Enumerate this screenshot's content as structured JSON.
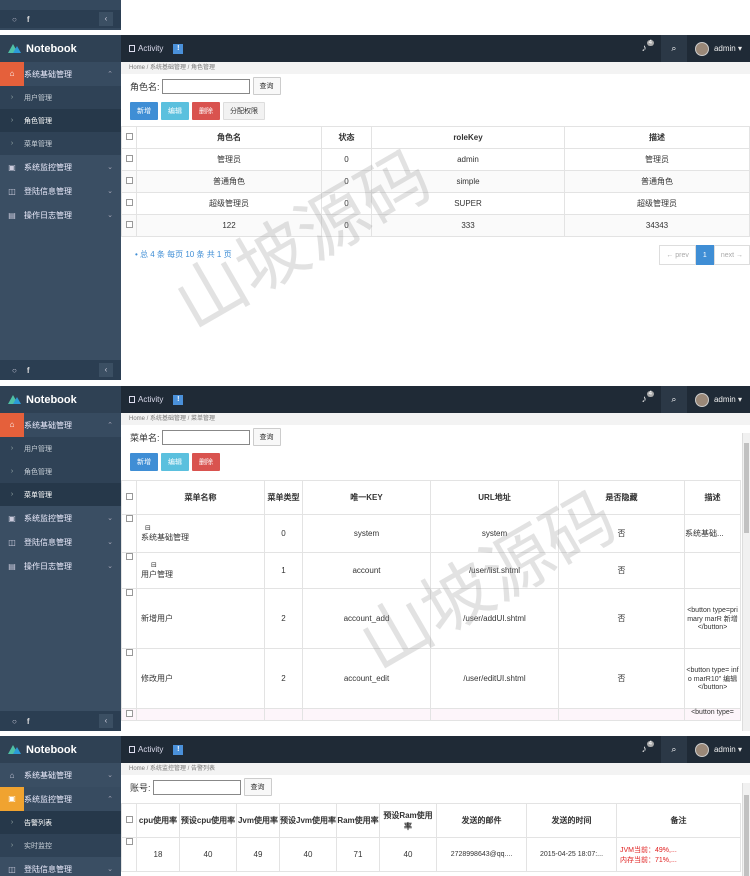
{
  "brand": "Notebook",
  "activity": "Activity",
  "info_badge": "!",
  "bell_badge": "4",
  "user": "admin",
  "watermark": "山坡源码",
  "frag": {
    "fb": "f"
  },
  "shot1": {
    "crumb": "Home / 系统基础管理 / 角色管理",
    "search_label": "角色名:",
    "query": "查询",
    "buttons": [
      "新增",
      "编辑",
      "删除",
      "分配权限"
    ],
    "nav": [
      {
        "label": "系统基础管理",
        "open": true
      },
      {
        "sub": "用户管理"
      },
      {
        "sub": "角色管理",
        "active": true
      },
      {
        "sub": "菜单管理"
      },
      {
        "label": "系统监控管理"
      },
      {
        "label": "登陆信息管理"
      },
      {
        "label": "操作日志管理"
      }
    ],
    "headers": [
      "角色名",
      "状态",
      "roleKey",
      "描述"
    ],
    "rows": [
      [
        "管理员",
        "0",
        "admin",
        "管理员"
      ],
      [
        "普通角色",
        "0",
        "simple",
        "普通角色"
      ],
      [
        "超级管理员",
        "0",
        "SUPER",
        "超级管理员"
      ],
      [
        "122",
        "0",
        "333",
        "34343"
      ]
    ],
    "pager_info": "• 总 4 条  每页 10 条  共 1 页",
    "prev": "← prev",
    "page": "1",
    "next": "next →"
  },
  "shot2": {
    "crumb": "Home / 系统基础管理 / 菜单管理",
    "search_label": "菜单名:",
    "query": "查询",
    "buttons": [
      "新增",
      "编辑",
      "删除"
    ],
    "nav": [
      {
        "label": "系统基础管理",
        "open": true
      },
      {
        "sub": "用户管理"
      },
      {
        "sub": "角色管理"
      },
      {
        "sub": "菜单管理",
        "active": true
      },
      {
        "label": "系统监控管理"
      },
      {
        "label": "登陆信息管理"
      },
      {
        "label": "操作日志管理"
      }
    ],
    "headers": [
      "菜单名称",
      "菜单类型",
      "唯一KEY",
      "URL地址",
      "是否隐藏",
      "描述"
    ],
    "rows": [
      {
        "name": "系统基础管理",
        "pre": "⊟",
        "type": "0",
        "key": "system",
        "url": "system",
        "hidden": "否",
        "desc": "系统基础..."
      },
      {
        "name": "用户管理",
        "pre": "⊟",
        "type": "1",
        "key": "account",
        "url": "/user/list.shtml",
        "hidden": "否",
        "desc": ""
      },
      {
        "name": "新增用户",
        "pre": "",
        "type": "2",
        "key": "account_add",
        "url": "/user/addUI.shtml",
        "hidden": "否",
        "desc": "<button type=primary marR 新增 </button>"
      },
      {
        "name": "修改用户",
        "pre": "",
        "type": "2",
        "key": "account_edit",
        "url": "/user/editUI.shtml",
        "hidden": "否",
        "desc": "<button type= info marR10\" 编辑 </button>"
      }
    ],
    "last_desc": "<button type="
  },
  "shot3": {
    "crumb": "Home / 系统监控管理 / 告警列表",
    "search_label": "账号:",
    "query": "查询",
    "nav": [
      {
        "label": "系统基础管理"
      },
      {
        "label": "系统监控管理",
        "open": true
      },
      {
        "sub": "告警列表",
        "active": true
      },
      {
        "sub": "实时监控"
      },
      {
        "label": "登陆信息管理"
      }
    ],
    "headers": [
      "cpu使用率",
      "预设cpu使用率",
      "Jvm使用率",
      "预设Jvm使用率",
      "Ram使用率",
      "预设Ram使用率",
      "发送的邮件",
      "发送的时间",
      "备注"
    ],
    "row": [
      "18",
      "40",
      "49",
      "40",
      "71",
      "40",
      "2728998643@qq....",
      "2015-04-25 18:07:..."
    ],
    "note1": "JVM当前：49%,...",
    "note2": "内存当前：71%,..."
  }
}
